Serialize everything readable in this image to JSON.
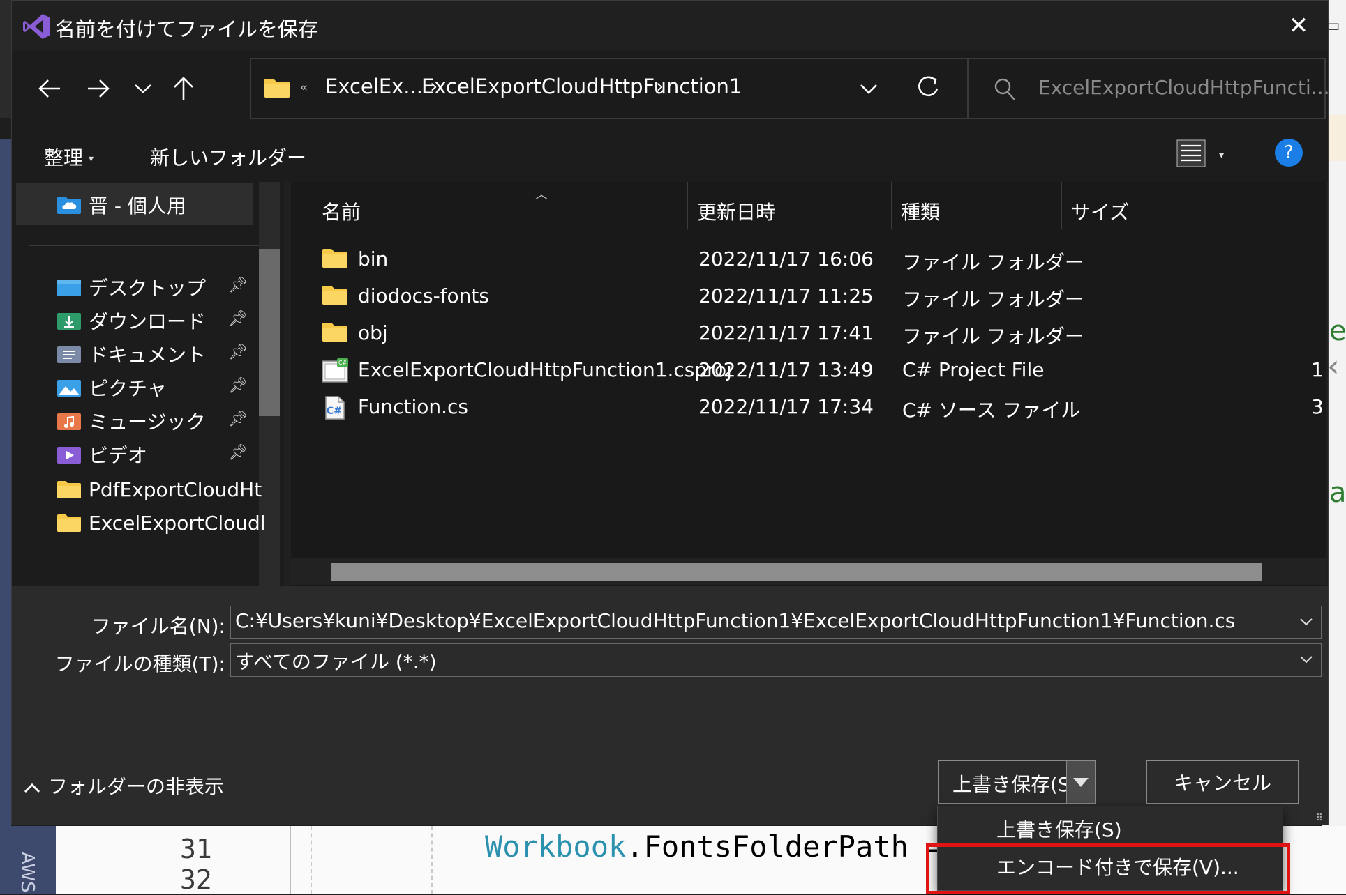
{
  "dialog": {
    "title": "名前を付けてファイルを保存",
    "close_glyph": "✕"
  },
  "address": {
    "overflow": "«",
    "crumbs": [
      "ExcelEx...",
      "ExcelExportCloudHttpFunction1"
    ]
  },
  "search": {
    "placeholder": "ExcelExportCloudHttpFuncti..."
  },
  "toolbar": {
    "organize": "整理",
    "new_folder": "新しいフォルダー",
    "help": "?"
  },
  "nav": {
    "items": [
      {
        "label": "晋 - 個人用",
        "icon": "onedrive-icon"
      },
      {
        "label": "デスクトップ",
        "icon": "desktop-folder-icon",
        "pinned": true
      },
      {
        "label": "ダウンロード",
        "icon": "downloads-folder-icon",
        "pinned": true
      },
      {
        "label": "ドキュメント",
        "icon": "documents-folder-icon",
        "pinned": true
      },
      {
        "label": "ピクチャ",
        "icon": "pictures-folder-icon",
        "pinned": true
      },
      {
        "label": "ミュージック",
        "icon": "music-folder-icon",
        "pinned": true
      },
      {
        "label": "ビデオ",
        "icon": "videos-folder-icon",
        "pinned": true
      },
      {
        "label": "PdfExportCloudHt",
        "icon": "folder-icon"
      },
      {
        "label": "ExcelExportCloudl",
        "icon": "folder-icon"
      }
    ]
  },
  "files": {
    "columns": {
      "name": "名前",
      "date": "更新日時",
      "type": "種類",
      "size": "サイズ"
    },
    "rows": [
      {
        "name": "bin",
        "date": "2022/11/17 16:06",
        "type": "ファイル フォルダー",
        "size": "",
        "icon": "folder-icon"
      },
      {
        "name": "diodocs-fonts",
        "date": "2022/11/17 11:25",
        "type": "ファイル フォルダー",
        "size": "",
        "icon": "folder-icon"
      },
      {
        "name": "obj",
        "date": "2022/11/17 17:41",
        "type": "ファイル フォルダー",
        "size": "",
        "icon": "folder-icon"
      },
      {
        "name": "ExcelExportCloudHttpFunction1.csproj",
        "date": "2022/11/17 13:49",
        "type": "C# Project File",
        "size": "1",
        "icon": "csproj-file-icon"
      },
      {
        "name": "Function.cs",
        "date": "2022/11/17 17:34",
        "type": "C# ソース ファイル",
        "size": "3",
        "icon": "csharp-file-icon"
      }
    ]
  },
  "form": {
    "filename_label": "ファイル名(N):",
    "filename_value": "C:¥Users¥kuni¥Desktop¥ExcelExportCloudHttpFunction1¥ExcelExportCloudHttpFunction1¥Function.cs",
    "filetype_label": "ファイルの種類(T):",
    "filetype_value": "すべてのファイル (*.*)"
  },
  "footer": {
    "hide_folders": "フォルダーの非表示",
    "save_label": "上書き保存(S)",
    "cancel_label": "キャンセル"
  },
  "menu": {
    "items": [
      "上書き保存(S)",
      "エンコード付きで保存(V)..."
    ]
  },
  "background": {
    "line_numbers": [
      "31",
      "32"
    ],
    "code_class": "Workbook",
    "code_dot": ".",
    "code_member": "FontsFolderPath",
    "code_op": " = ",
    "code_str": "\"",
    "side_tab": "AWS",
    "right_chars": [
      "e",
      "a"
    ]
  },
  "colors": {
    "accent": "#1a7ee6",
    "highlight": "#e01414",
    "folder": "#f7c948"
  }
}
